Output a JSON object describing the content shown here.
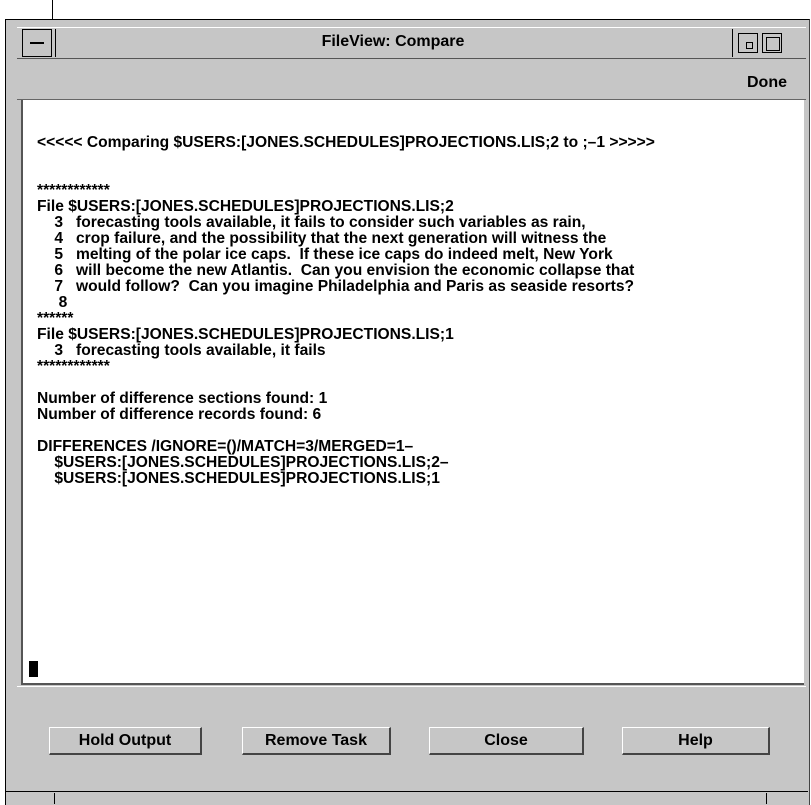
{
  "window": {
    "title": "FileView: Compare"
  },
  "toolbar": {
    "done_label": "Done"
  },
  "output": {
    "lines": [
      "<<<<< Comparing $USERS:[JONES.SCHEDULES]PROJECTIONS.LIS;2 to ;–1 >>>>>",
      "",
      "",
      "************",
      "File $USERS:[JONES.SCHEDULES]PROJECTIONS.LIS;2",
      "    3   forecasting tools available, it fails to consider such variables as rain,",
      "    4   crop failure, and the possibility that the next generation will witness the",
      "    5   melting of the polar ice caps.  If these ice caps do indeed melt, New York",
      "    6   will become the new Atlantis.  Can you envision the economic collapse that",
      "    7   would follow?  Can you imagine Philadelphia and Paris as seaside resorts?",
      "     8",
      "******",
      "File $USERS:[JONES.SCHEDULES]PROJECTIONS.LIS;1",
      "    3   forecasting tools available, it fails",
      "************",
      "",
      "Number of difference sections found: 1",
      "Number of difference records found: 6",
      "",
      "DIFFERENCES /IGNORE=()/MATCH=3/MERGED=1–",
      "    $USERS:[JONES.SCHEDULES]PROJECTIONS.LIS;2–",
      "    $USERS:[JONES.SCHEDULES]PROJECTIONS.LIS;1"
    ]
  },
  "buttons": {
    "hold_output": "Hold Output",
    "remove_task": "Remove Task",
    "close": "Close",
    "help": "Help"
  },
  "icons": {
    "window_menu": "window-menu-icon",
    "minimize": "minimize-icon",
    "maximize": "maximize-icon"
  }
}
